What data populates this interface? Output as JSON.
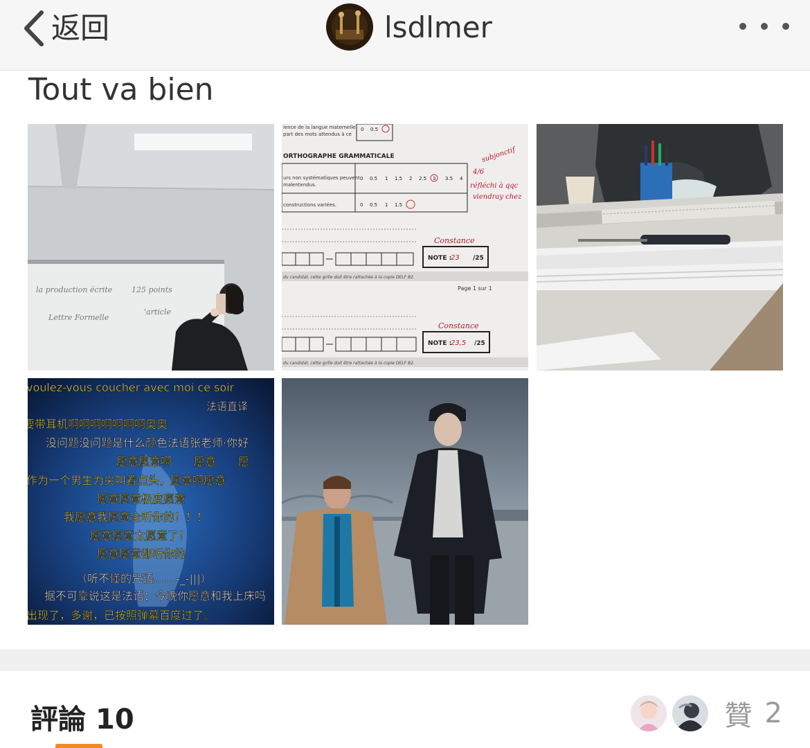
{
  "header": {
    "back_label": "返回",
    "username": "lsdlmer"
  },
  "post": {
    "text": "Tout va bien"
  },
  "images": [
    {
      "icon": "whiteboard-photo",
      "whiteboard_text": [
        "la production écrite",
        "125 points",
        "Lettre Formelle",
        "'article"
      ]
    },
    {
      "icon": "exam-sheet-photo",
      "sheet": {
        "header_line1": "ience de la langue maternelle.",
        "header_line2": "part des mots attendus à ce",
        "section": "ORTHOGRAPHE GRAMMATICALE",
        "row1": "urs non systématiques peuvent",
        "row1b": "malentendus.",
        "row2": "constructions variées.",
        "scores": [
          "0",
          "0.5",
          "1",
          "1.5",
          "2",
          "2.5",
          "3",
          "3.5",
          "4"
        ],
        "annotation": [
          "subjonctif",
          "4/6",
          "réfléchi à qqc",
          "viendray chez"
        ],
        "name1": "Constance",
        "note1_label": "NOTE :",
        "note1_value": "23",
        "note1_total": "/25",
        "footer": "du candidat, cette grille doit être rattachée à la copie DELF B2.",
        "page": "Page 1 sur 1",
        "name2": "Constance",
        "note2_label": "NOTE :",
        "note2_value": "23,5",
        "note2_total": "/25",
        "footer2": "du candidat, cette grille doit être rattachée à la copie DELF B2."
      }
    },
    {
      "icon": "desk-papers-photo"
    },
    {
      "icon": "bullet-comments-video-frame",
      "lines": [
        "voulez-vous coucher avec moi ce soir",
        "法语直译",
        "要带耳机啊啊啊啊啊啊啊奥奥",
        "没问题没问题是什么颜色法语张老师·你好",
        "愿意愿意啊　　愿意　　愿",
        "作为一个男生为尖叫着点头，愿意啊愿意",
        "愿意愿意极度愿意",
        "我愿意我愿意全听你的！！！",
        "愿意愿意太愿意了！",
        "愿意愿意都听你的",
        "（听不懂的咒语……-_-|||）",
        "据不可靠说这是法语：今晚你愿意和我上床吗",
        "出现了，多谢，已按照弹幕百度过了。"
      ]
    },
    {
      "icon": "movie-still-photo"
    }
  ],
  "comments": {
    "label": "評論",
    "count": "10"
  },
  "likes": {
    "label": "贊",
    "count": "2"
  },
  "colors": {
    "accent": "#f08a24",
    "header_bg": "#f6f6f6",
    "muted": "#999999"
  }
}
